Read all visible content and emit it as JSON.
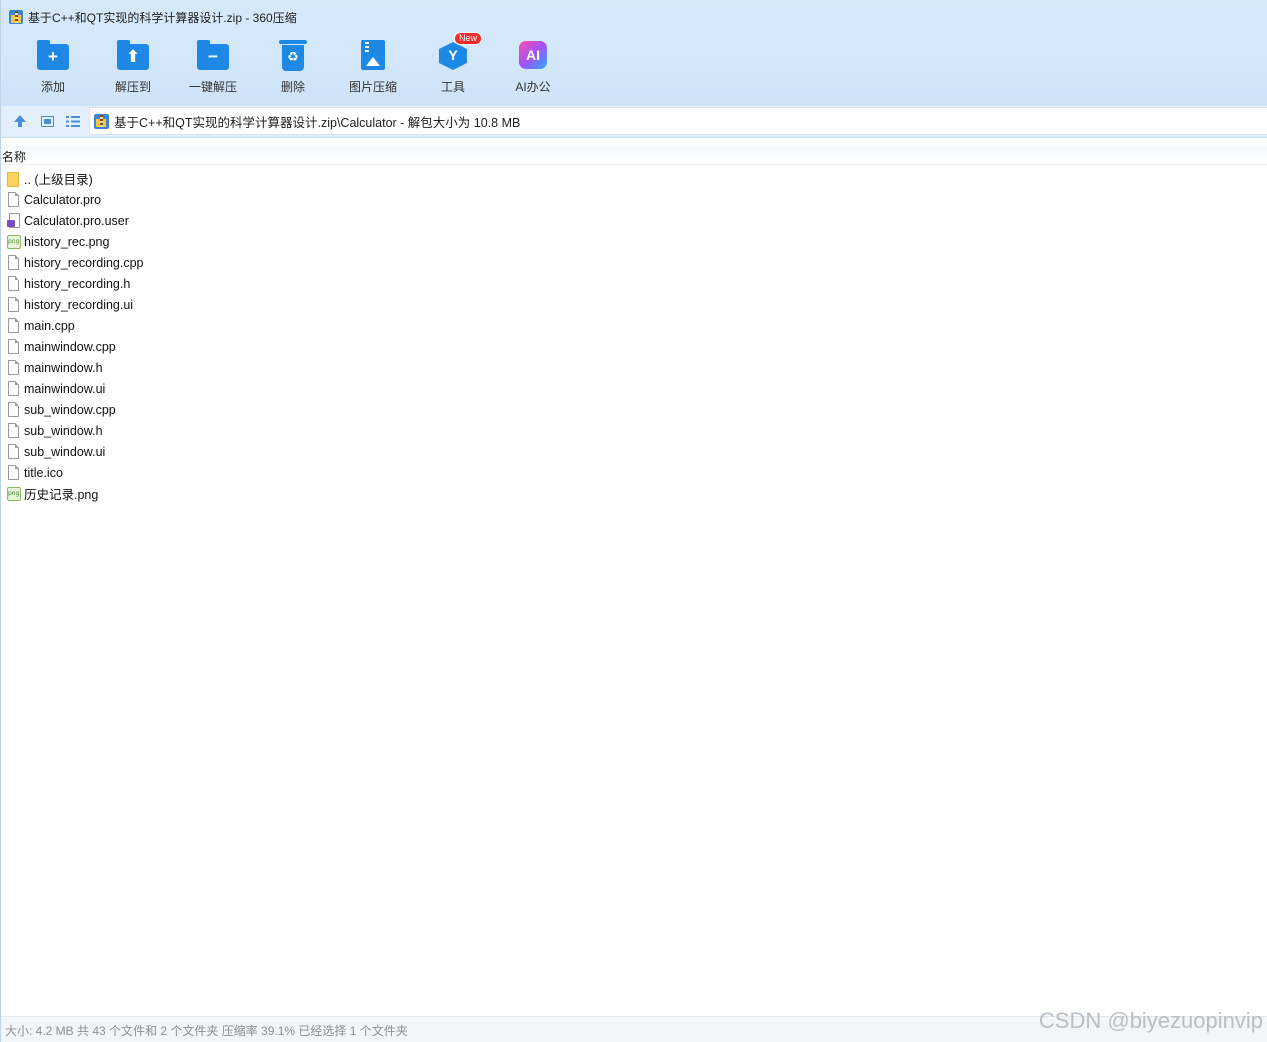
{
  "window": {
    "title": "基于C++和QT实现的科学计算器设计.zip - 360压缩"
  },
  "toolbar": {
    "items": [
      {
        "label": "添加",
        "icon": "add-folder-icon"
      },
      {
        "label": "解压到",
        "icon": "extract-to-icon"
      },
      {
        "label": "一键解压",
        "icon": "one-click-extract-icon"
      },
      {
        "label": "删除",
        "icon": "recycle-bin-icon"
      },
      {
        "label": "图片压缩",
        "icon": "image-compress-icon"
      },
      {
        "label": "工具",
        "icon": "tools-cube-icon",
        "badge": "New"
      },
      {
        "label": "AI办公",
        "icon": "ai-office-icon",
        "glyph": "AI"
      }
    ]
  },
  "address": {
    "path": "基于C++和QT实现的科学计算器设计.zip\\Calculator - 解包大小为 10.8 MB"
  },
  "list": {
    "column_name": "名称",
    "items": [
      {
        "name": ".. (上级目录)",
        "icon": "folder-icon"
      },
      {
        "name": "Calculator.pro",
        "icon": "file-icon"
      },
      {
        "name": "Calculator.pro.user",
        "icon": "user-file-icon"
      },
      {
        "name": "history_rec.png",
        "icon": "png-icon"
      },
      {
        "name": "history_recording.cpp",
        "icon": "file-icon"
      },
      {
        "name": "history_recording.h",
        "icon": "file-icon"
      },
      {
        "name": "history_recording.ui",
        "icon": "file-icon"
      },
      {
        "name": "main.cpp",
        "icon": "file-icon"
      },
      {
        "name": "mainwindow.cpp",
        "icon": "file-icon"
      },
      {
        "name": "mainwindow.h",
        "icon": "file-icon"
      },
      {
        "name": "mainwindow.ui",
        "icon": "file-icon"
      },
      {
        "name": "sub_window.cpp",
        "icon": "file-icon"
      },
      {
        "name": "sub_window.h",
        "icon": "file-icon"
      },
      {
        "name": "sub_window.ui",
        "icon": "file-icon"
      },
      {
        "name": "title.ico",
        "icon": "file-icon"
      },
      {
        "name": "历史记录.png",
        "icon": "png-icon"
      }
    ]
  },
  "status": {
    "text": "大小: 4.2 MB 共 43 个文件和 2 个文件夹 压缩率 39.1% 已经选择 1 个文件夹"
  },
  "watermark": "CSDN @biyezuopinvip",
  "colors": {
    "toolbar_bg": "#d3e7fb",
    "icon_blue": "#1e88e5",
    "badge_red": "#f02c2c"
  }
}
